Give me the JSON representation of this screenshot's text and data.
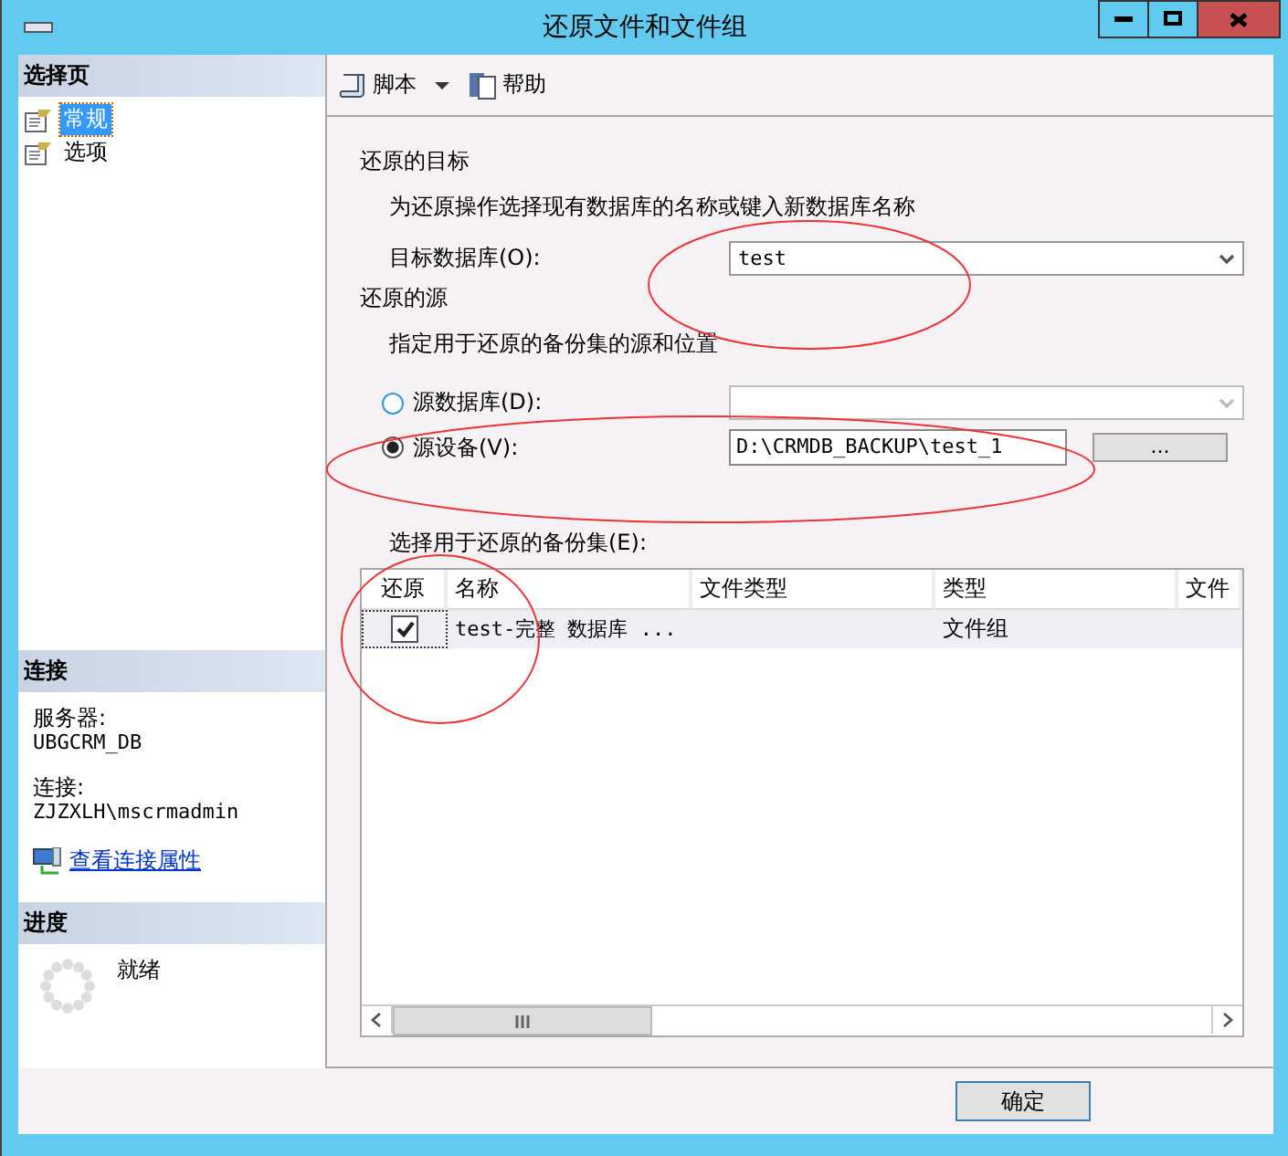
{
  "window": {
    "title": "还原文件和文件组"
  },
  "sidebar": {
    "header": "选择页",
    "items": [
      {
        "label": "常规",
        "selected": true
      },
      {
        "label": "选项",
        "selected": false
      }
    ]
  },
  "connection": {
    "header": "连接",
    "server_label": "服务器:",
    "server": "UBGCRM_DB",
    "connection_label": "连接:",
    "connection": "ZJZXLH\\mscrmadmin",
    "link": "查看连接属性"
  },
  "progress": {
    "header": "进度",
    "status": "就绪"
  },
  "toolbar": [
    {
      "label": "脚本",
      "kind": "dropdown"
    },
    {
      "label": "帮助",
      "kind": "plain"
    }
  ],
  "destination": {
    "heading": "还原的目标",
    "hint": "为还原操作选择现有数据库的名称或键入新数据库名称",
    "label": "目标数据库(O):",
    "value": "test"
  },
  "source": {
    "heading": "还原的源",
    "hint": "指定用于还原的备份集的源和位置",
    "options": [
      {
        "label": "源数据库(D):",
        "selected": false,
        "kind": "dropdown"
      },
      {
        "label": "源设备(V):",
        "selected": true,
        "kind": "path",
        "value": "D:\\CRMDB_BACKUP\\test_1",
        "browse": "..."
      }
    ]
  },
  "backup_sets": {
    "label": "选择用于还原的备份集(E):",
    "columns": [
      "还原",
      "名称",
      "文件类型",
      "类型",
      "文件"
    ],
    "rows": [
      {
        "checked": true,
        "name": "test-完整 数据库 ...",
        "type": "文件组"
      }
    ]
  },
  "buttons": [
    "确定"
  ]
}
